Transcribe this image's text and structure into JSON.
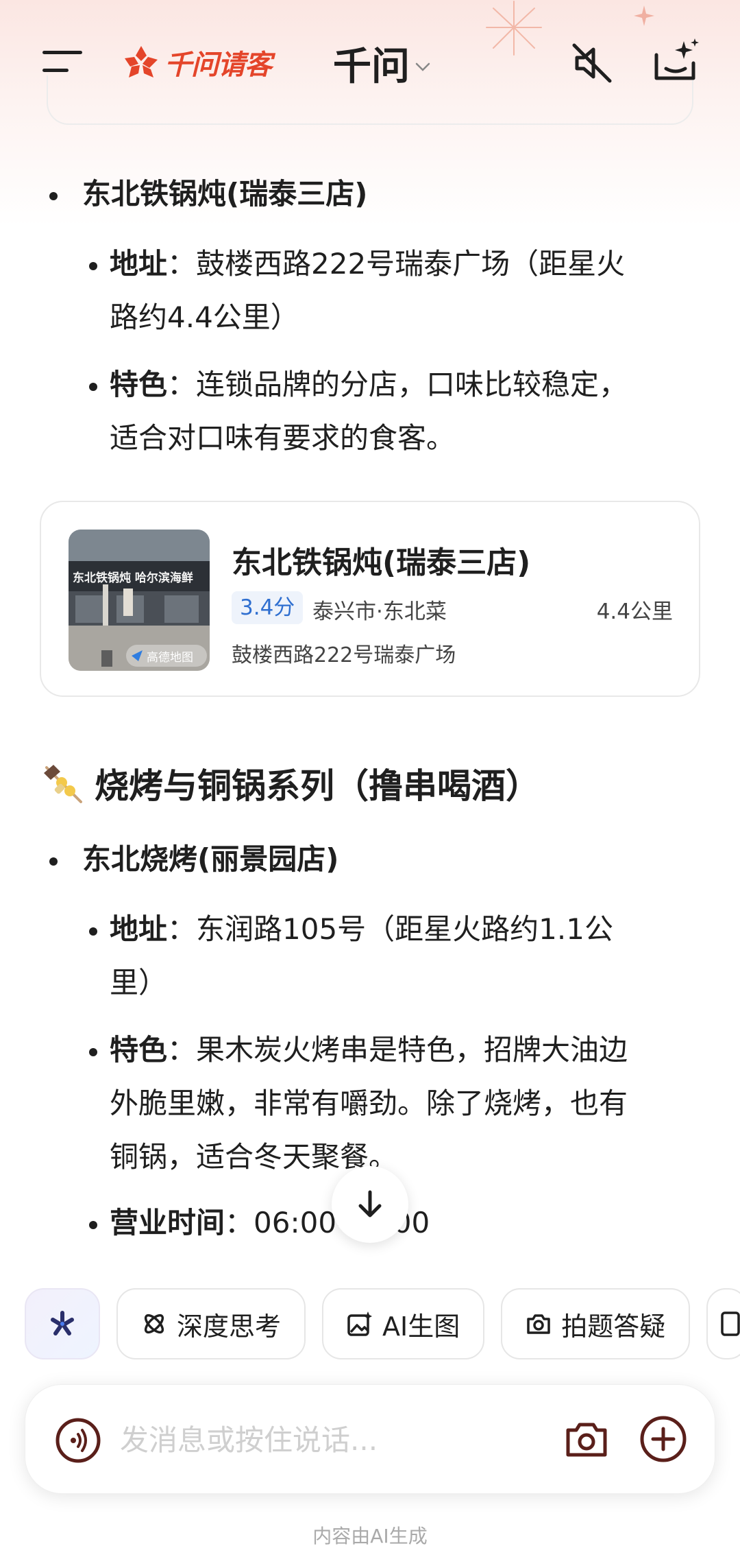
{
  "header": {
    "brand_text": "千问请客",
    "model_name": "千问",
    "icons": [
      "menu-icon",
      "brand-logo-icon",
      "chevron-down-icon",
      "speaker-muted-icon",
      "new-chat-sparkle-icon"
    ]
  },
  "shop1": {
    "name": "东北铁锅炖(瑞泰三店)",
    "address_label": "地址",
    "address_value": "：鼓楼西路222号瑞泰广场（距星火",
    "address_value_2": "路约4.4公里）",
    "feature_label": "特色",
    "feature_value": "：连锁品牌的分店，口味比较稳定，",
    "feature_value_2": "适合对口味有要求的食客。"
  },
  "place_card": {
    "title": "东北铁锅炖(瑞泰三店)",
    "rating": "3.4分",
    "meta": "泰兴市·东北菜",
    "distance": "4.4公里",
    "address": "鼓楼西路222号瑞泰广场",
    "photo_sign": "东北铁锅炖  哈尔滨海鲜",
    "photo_watermark": "高德地图"
  },
  "section": {
    "title": "烧烤与铜锅系列（撸串喝酒）",
    "icon": "skewer-icon"
  },
  "shop2": {
    "name": "东北烧烤(丽景园店)",
    "address_label": "地址",
    "address_value": "：东润路105号（距星火路约1.1公",
    "address_value_2": "里）",
    "feature_label": "特色",
    "feature_value": "：果木炭火烤串是特色，招牌大油边",
    "feature_value_2": "外脆里嫩，非常有嚼劲。除了烧烤，也有",
    "feature_value_3": "铜锅，适合冬天聚餐。",
    "hours_label": "营业时间",
    "hours_value": "：06:00-23:00"
  },
  "chips": [
    {
      "label": "",
      "icon": "qwen-star-icon"
    },
    {
      "label": "深度思考",
      "icon": "deep-think-icon"
    },
    {
      "label": "AI生图",
      "icon": "image-gen-icon"
    },
    {
      "label": "拍题答疑",
      "icon": "photo-question-icon"
    }
  ],
  "input": {
    "placeholder": "发消息或按住说话..."
  },
  "footer": {
    "note": "内容由AI生成"
  },
  "colors": {
    "brand_red": "#e4452a",
    "rating_blue": "#2f6fd0",
    "accent_dark": "#5a1f1a"
  }
}
